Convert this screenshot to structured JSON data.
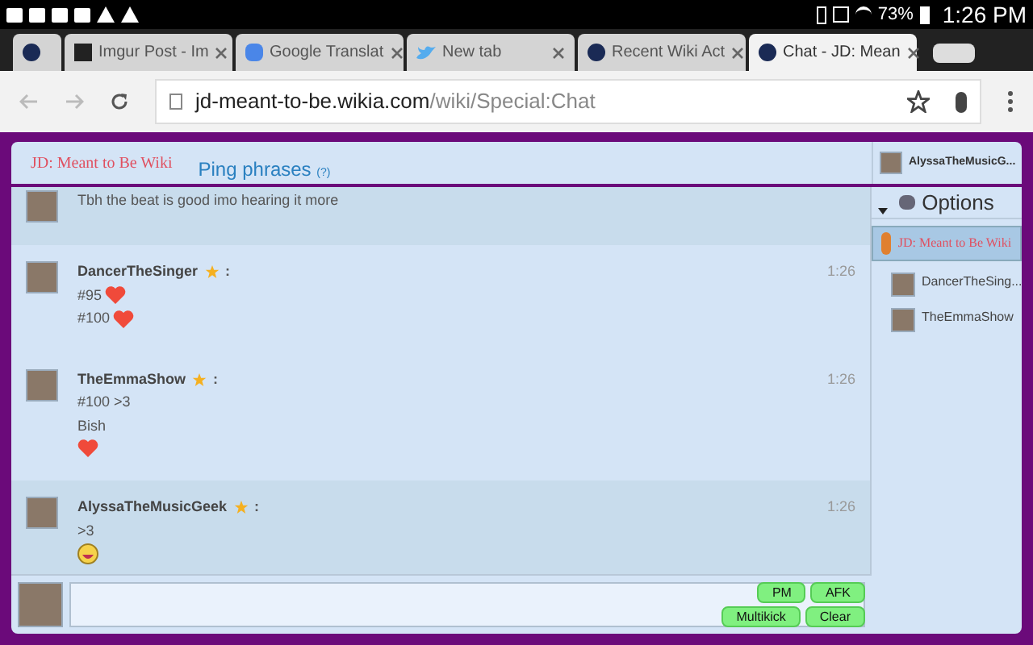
{
  "status_bar": {
    "battery": "73%",
    "time": "1:26 PM"
  },
  "tabs": [
    {
      "kind": "wiki",
      "selected": false
    },
    {
      "label": "Imgur Post - Im",
      "kind": "imgur",
      "selected": false
    },
    {
      "label": "Google Translat",
      "kind": "translate",
      "selected": false
    },
    {
      "label": "New tab",
      "kind": "bird",
      "selected": false
    },
    {
      "label": "Recent Wiki Act",
      "kind": "wiki",
      "selected": false
    },
    {
      "label": "Chat - JD: Mean",
      "kind": "wiki",
      "selected": true
    }
  ],
  "address_bar": {
    "domain": "jd-meant-to-be.wikia.com",
    "path": "/wiki/Special:Chat"
  },
  "chat_header": {
    "logo": "JD: Meant to Be Wiki",
    "ping_phrases": "Ping phrases",
    "ping_help": "(?)",
    "user": "AlyssaTheMusicG..."
  },
  "messages": [
    {
      "highlighted": true,
      "lines": [
        [
          {
            "kind": "text",
            "text": "Tbh the beat is good imo hearing it more"
          }
        ]
      ]
    },
    {
      "user": "DancerTheSinger",
      "separator": ":",
      "time": "1:26",
      "highlighted": false,
      "lines": [
        [
          {
            "kind": "text",
            "text": "#95"
          },
          {
            "kind": "heart"
          }
        ],
        [
          {
            "kind": "text",
            "text": "#100"
          },
          {
            "kind": "heart"
          }
        ]
      ]
    },
    {
      "user": "TheEmmaShow",
      "separator": ":",
      "time": "1:26",
      "highlighted": false,
      "lines": [
        [
          {
            "kind": "text",
            "text": "#100 >3"
          }
        ],
        [
          {
            "kind": "text",
            "text": "Bish"
          }
        ],
        [
          {
            "kind": "heart"
          }
        ]
      ]
    },
    {
      "user": "AlyssaTheMusicGeek",
      "separator": ":",
      "time": "1:26",
      "highlighted": true,
      "lines": [
        [
          {
            "kind": "text",
            "text": ">3"
          }
        ],
        [
          {
            "kind": "laugh"
          }
        ]
      ]
    }
  ],
  "sidebar": {
    "options": "Options",
    "room": "JD: Meant to Be Wiki",
    "users": [
      {
        "name": "DancerTheSing..."
      },
      {
        "name": "TheEmmaShow"
      }
    ]
  },
  "input": {
    "buttons": [
      [
        "PM",
        "AFK"
      ],
      [
        "Multikick",
        "Clear"
      ]
    ]
  }
}
